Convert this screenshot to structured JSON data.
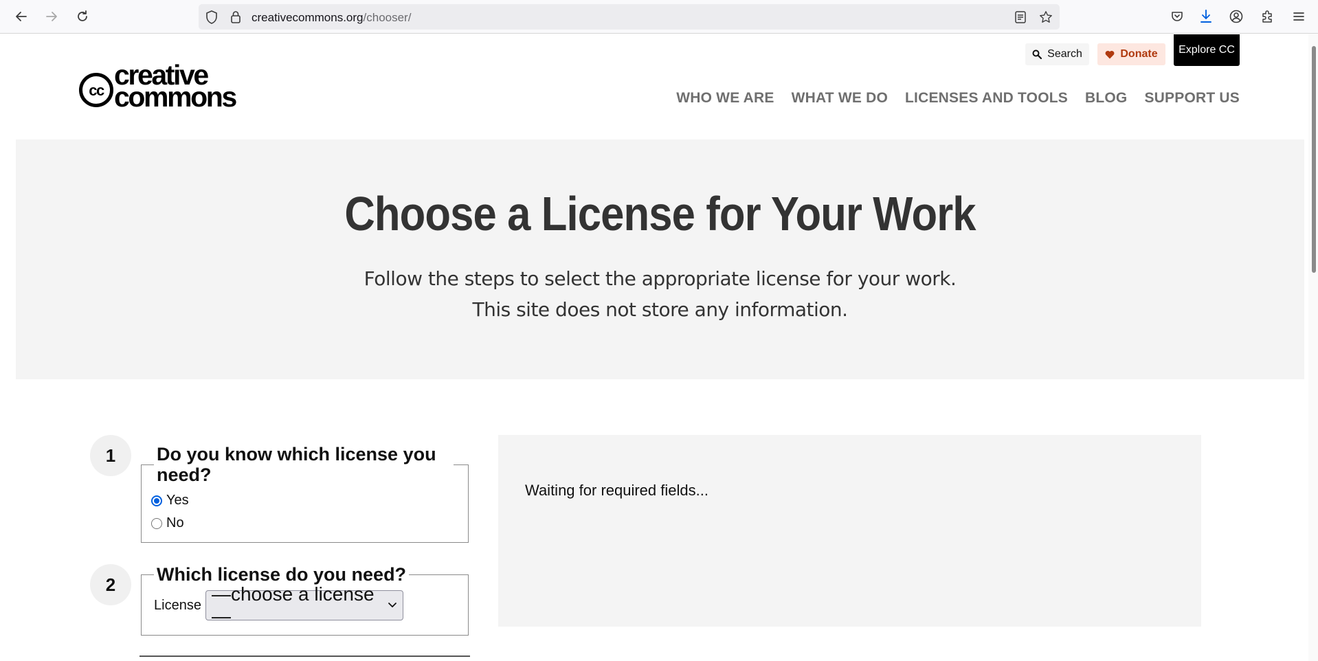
{
  "browser": {
    "url_domain": "creativecommons.org",
    "url_path": "/chooser/",
    "icons": [
      "back-icon",
      "forward-icon",
      "reload-icon",
      "shield-icon",
      "lock-icon",
      "reader-view-icon",
      "bookmark-star-icon",
      "pocket-icon",
      "download-icon",
      "account-icon",
      "extensions-icon",
      "menu-icon"
    ]
  },
  "header": {
    "search_label": "Search",
    "donate_label": "Donate",
    "explore_label": "Explore CC",
    "logo": {
      "mark": "cc",
      "word_top": "creative",
      "word_bottom": "commons"
    },
    "nav": [
      {
        "label": "WHO WE ARE"
      },
      {
        "label": "WHAT WE DO"
      },
      {
        "label": "LICENSES AND TOOLS"
      },
      {
        "label": "BLOG"
      },
      {
        "label": "SUPPORT US"
      }
    ]
  },
  "hero": {
    "title": "Choose a License for Your Work",
    "line1": "Follow the steps to select the appropriate license for your work.",
    "line2": "This site does not store any information."
  },
  "steps": {
    "step1": {
      "number": "1",
      "question": "Do you know which license you need?",
      "options": [
        {
          "label": "Yes",
          "checked": true
        },
        {
          "label": "No",
          "checked": false
        }
      ]
    },
    "step2": {
      "number": "2",
      "question": "Which license do you need?",
      "field_label": "License",
      "selected": "—choose a license—"
    }
  },
  "result": {
    "status": "Waiting for required fields..."
  },
  "colors": {
    "accent": "#0060df",
    "donate_bg": "#fde7e0",
    "donate_text": "#b03a0f",
    "hero_bg": "#f4f4f4",
    "explore_bg": "#000000"
  }
}
